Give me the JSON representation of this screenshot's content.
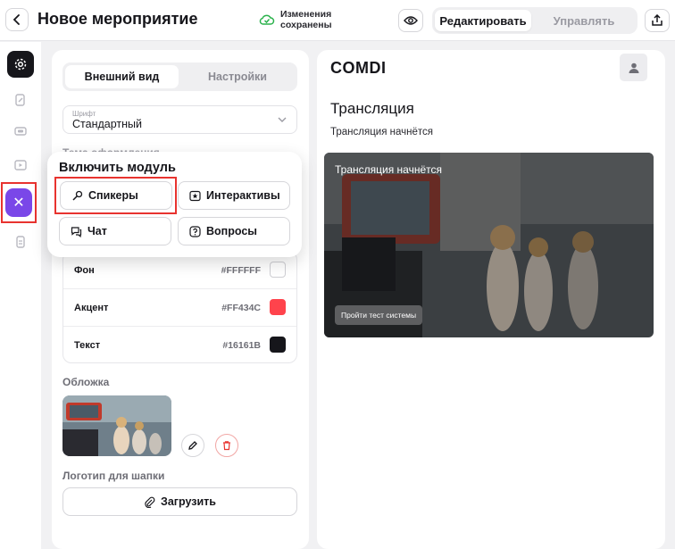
{
  "header": {
    "title": "Новое мероприятие",
    "saved_status": "Изменения сохранены",
    "mode_edit": "Редактировать",
    "mode_manage": "Управлять"
  },
  "settings": {
    "tab_appearance": "Внешний вид",
    "tab_settings": "Настройки",
    "font_label": "Шрифт",
    "font_value": "Стандартный",
    "theme_label": "Тема оформления",
    "colors": [
      {
        "name": "Фон",
        "hex": "#FFFFFF"
      },
      {
        "name": "Акцент",
        "hex": "#FF434C"
      },
      {
        "name": "Текст",
        "hex": "#16161B"
      }
    ],
    "cover_label": "Обложка",
    "logo_label": "Логотип для шапки",
    "upload_label": "Загрузить"
  },
  "popup": {
    "title": "Включить модуль",
    "modules": [
      "Спикеры",
      "Интерактивы",
      "Чат",
      "Вопросы"
    ]
  },
  "preview": {
    "brand": "COMDI",
    "title": "Трансляция",
    "subtitle": "Трансляция начнётся",
    "video_text": "Трансляция начнётся",
    "video_button": "Пройти тест системы"
  },
  "colors": {
    "accent": "#7a47e8",
    "highlight": "#e8332f",
    "dark": "#16161b"
  }
}
